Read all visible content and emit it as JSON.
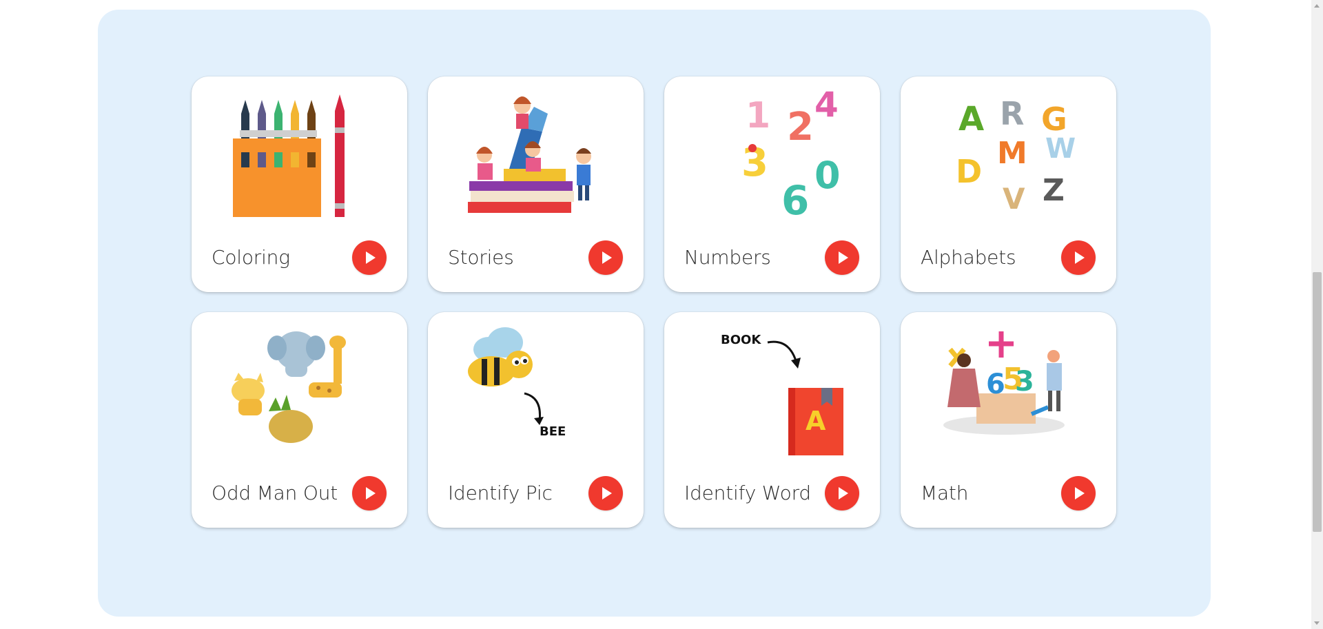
{
  "colors": {
    "panel_bg": "#e2f0fc",
    "card_bg": "#ffffff",
    "play_button": "#f0392e"
  },
  "cards": [
    {
      "label": "Coloring",
      "icon": "crayons-icon"
    },
    {
      "label": "Stories",
      "icon": "kids-reading-books-icon"
    },
    {
      "label": "Numbers",
      "icon": "cartoon-numbers-icon"
    },
    {
      "label": "Alphabets",
      "icon": "animal-letters-icon"
    },
    {
      "label": "Odd Man Out",
      "icon": "animals-and-pineapple-icon"
    },
    {
      "label": "Identify Pic",
      "icon": "bee-picture-icon",
      "image_text": "BEE"
    },
    {
      "label": "Identify Word",
      "icon": "book-word-icon",
      "image_text": "BOOK",
      "book_letter": "A"
    },
    {
      "label": "Math",
      "icon": "kids-with-math-symbols-icon"
    }
  ]
}
